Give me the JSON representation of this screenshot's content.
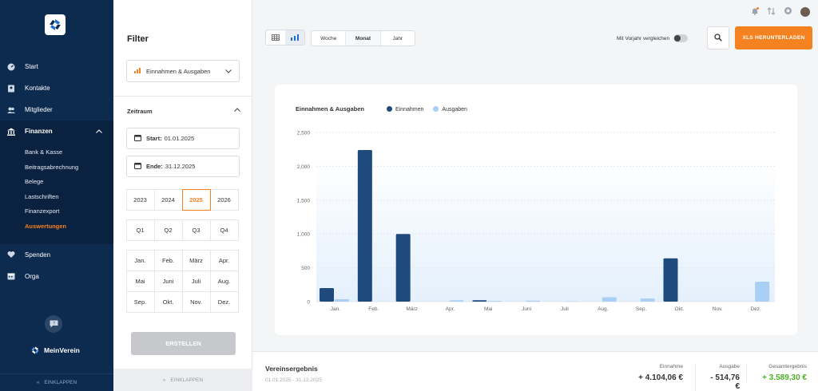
{
  "sidebar": {
    "items": [
      {
        "label": "Start",
        "icon": "speedometer-icon"
      },
      {
        "label": "Kontakte",
        "icon": "contact-card-icon"
      },
      {
        "label": "Mitglieder",
        "icon": "people-icon"
      },
      {
        "label": "Finanzen",
        "icon": "bank-icon"
      }
    ],
    "sub_items": [
      "Bank & Kasse",
      "Beitragsabrechnung",
      "Belege",
      "Lastschriften",
      "Finanzexport",
      "Auswertungen"
    ],
    "items_after": [
      {
        "label": "Spenden",
        "icon": "donation-icon"
      },
      {
        "label": "Orga",
        "icon": "calendar-icon"
      }
    ],
    "brand": "MeinVerein",
    "collapse_label": "EINKLAPPEN",
    "current_sub": "Auswertungen"
  },
  "filter": {
    "title": "Filter",
    "type_select": "Einnahmen & Ausgaben",
    "zeitraum_label": "Zeitraum",
    "start_label": "Start:",
    "start_value": "01.01.2025",
    "end_label": "Ende:",
    "end_value": "31.12.2025",
    "years": [
      "2023",
      "2024",
      "2025",
      "2026"
    ],
    "selected_year": "2025",
    "quarters": [
      "Q1",
      "Q2",
      "Q3",
      "Q4"
    ],
    "months": [
      "Jan.",
      "Feb.",
      "März",
      "Apr.",
      "Mai",
      "Juni",
      "Juli",
      "Aug.",
      "Sep.",
      "Okt.",
      "Nov.",
      "Dez."
    ],
    "create_label": "ERSTELLEN",
    "collapse_label": "EINKLAPPEN"
  },
  "toolbar": {
    "ranges": [
      "Woche",
      "Monat",
      "Jahr"
    ],
    "selected_range": "Monat",
    "compare_label": "Mit Vorjahr vergleichen",
    "xls_label": "XLS HERUNTERLADEN"
  },
  "chart_title": "Einnahmen & Ausgaben",
  "chart_data": {
    "type": "bar",
    "categories": [
      "Jan.",
      "Feb.",
      "März",
      "Apr.",
      "Mai",
      "Juni",
      "Juli",
      "Aug.",
      "Sep.",
      "Okt.",
      "Nov.",
      "Dez."
    ],
    "series": [
      {
        "name": "Einnahmen",
        "color": "#1f4a7c",
        "values": [
          200,
          2240,
          1000,
          0,
          20,
          0,
          0,
          0,
          0,
          640,
          0,
          0
        ]
      },
      {
        "name": "Ausgaben",
        "color": "#a9cff4",
        "values": [
          35,
          0,
          0,
          20,
          10,
          15,
          5,
          65,
          45,
          0,
          0,
          295
        ]
      }
    ],
    "yticks": [
      "0",
      "500",
      "1,000",
      "1,500",
      "2,000",
      "2,500"
    ],
    "ylim": [
      0,
      2500
    ],
    "grid": true,
    "legend": "top-left"
  },
  "footer": {
    "title": "Vereinsergebnis",
    "date_range": "01.01.2025 - 31.12.2025",
    "einnahme_label": "Einnahme",
    "einnahme_value": "+ 4.104,06 €",
    "ausgabe_label": "Ausgabe",
    "ausgabe_value": "- 514,76 €",
    "gesamt_label": "Gesamtergebnis",
    "gesamt_value": "+ 3.589,30 €",
    "gesamt_color": "#4caf2a"
  }
}
